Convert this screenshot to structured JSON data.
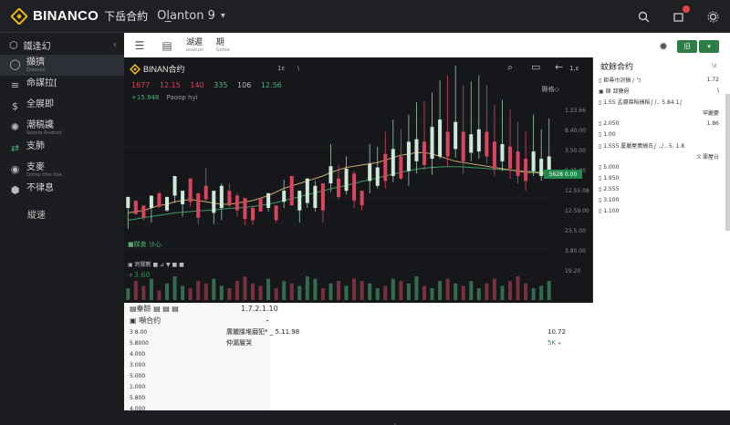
{
  "topbar": {
    "brand": "BINANCO",
    "brand_sub": "下岳合約",
    "account": "Ol̲anton 9",
    "caret": "▾"
  },
  "sidebar": {
    "header": "鐵逢幻",
    "items": [
      {
        "label": "擷擠",
        "sub": "Dolanoo",
        "icon": "circle-icon",
        "active": true
      },
      {
        "label": "命謀拉[",
        "sub": "",
        "icon": "lines-icon",
        "active": false
      },
      {
        "label": "全展即",
        "sub": "",
        "icon": "dollar-icon",
        "active": false
      },
      {
        "label": "潮稿讒",
        "sub": "Sdouta Rusbisd",
        "icon": "gear-icon",
        "active": false
      },
      {
        "label": "支肺",
        "sub": "",
        "icon": "swap-icon",
        "active": false
      },
      {
        "label": "支麥",
        "sub": "Dolleo tthe ihte",
        "icon": "circle-dot-icon",
        "active": false
      },
      {
        "label": "不律息",
        "sub": "",
        "icon": "cube-icon",
        "active": false
      }
    ],
    "footer": "縱速"
  },
  "toolbar": {
    "label_a": "湖遲",
    "label_a_sub": "ooatuoi",
    "label_b": "期",
    "label_b_sub": "Gotoe",
    "btn": "旧 "
  },
  "chart": {
    "title": "BINAN合约",
    "tf1": "1ε",
    "tf2": "\\",
    "right_text": "1.ε",
    "ohlc": [
      "1677",
      "12.15",
      "140",
      "335",
      "106",
      "12.56"
    ],
    "vol_text": "+15.948",
    "vol_text2": "Paoop hyi",
    "hold_text": "縣格◇",
    "price_tag": "5628 0.00",
    "y_ticks": [
      "1.23.66",
      "8.40.00",
      "3.50.00",
      "8.25.00",
      "12.55.08",
      "12.59.00",
      "23.5.00",
      "3.80.00",
      "19.20"
    ],
    "ma_label": "■牒奠 沙心",
    "ind_label": "▣ 跨關數  ■ ⊿  ▼ ■ ■",
    "ind_value": "+3.60"
  },
  "chart_data": {
    "type": "candlestick",
    "candles": [
      [
        0.0,
        -0.55,
        0.3,
        0.75,
        1
      ],
      [
        0.4,
        0.1,
        0.05,
        0.6,
        0
      ],
      [
        0.0,
        -0.2,
        -0.1,
        0.4,
        0
      ],
      [
        0.2,
        -0.3,
        0.3,
        0.8,
        1
      ],
      [
        0.6,
        0.3,
        0.35,
        0.9,
        0
      ],
      [
        0.4,
        0.15,
        0.2,
        0.75,
        1
      ],
      [
        0.5,
        0.5,
        0.8,
        1.6,
        1
      ],
      [
        0.4,
        -0.05,
        0.45,
        1.0,
        1
      ],
      [
        0.9,
        0.35,
        0.55,
        1.5,
        0
      ],
      [
        0.7,
        -0.35,
        -0.1,
        0.9,
        0
      ],
      [
        1.3,
        0.5,
        0.65,
        1.2,
        0
      ],
      [
        0.6,
        -0.35,
        0.1,
        1.0,
        1
      ],
      [
        1.0,
        -0.2,
        0.3,
        1.2,
        1
      ],
      [
        0.9,
        0.35,
        0.4,
        1.0,
        0
      ],
      [
        0.7,
        -0.05,
        0.2,
        0.8,
        0
      ],
      [
        0.6,
        -0.4,
        -0.15,
        0.7,
        0
      ],
      [
        0.6,
        -0.4,
        -0.2,
        0.3,
        0
      ],
      [
        0.5,
        0.45,
        0.15,
        0.7,
        0
      ],
      [
        0.6,
        0.15,
        0.3,
        0.9,
        1
      ],
      [
        0.1,
        -0.3,
        -0.2,
        0.4,
        0
      ],
      [
        0.9,
        0.3,
        0.55,
        1.0,
        1
      ],
      [
        1.2,
        0.4,
        0.4,
        1.6,
        0
      ],
      [
        0.5,
        -0.3,
        0.2,
        1.0,
        1
      ],
      [
        0.9,
        0.3,
        0.5,
        1.5,
        1
      ],
      [
        1.1,
        0.15,
        0.3,
        1.2,
        1
      ],
      [
        0.7,
        -0.3,
        0.2,
        1.3,
        0
      ],
      [
        1.6,
        0.95,
        1.3,
        2.0,
        1
      ],
      [
        1.3,
        0.65,
        0.75,
        1.5,
        0
      ],
      [
        1.4,
        0.85,
        1.0,
        1.9,
        1
      ],
      [
        1.2,
        0.3,
        0.6,
        1.7,
        0
      ],
      [
        0.6,
        0.2,
        0.4,
        1.0,
        0
      ],
      [
        1.5,
        0.9,
        1.4,
        2.1,
        1
      ],
      [
        1.6,
        1.1,
        1.2,
        1.95,
        1
      ],
      [
        2.0,
        1.1,
        1.4,
        2.5,
        0
      ],
      [
        2.3,
        1.35,
        1.6,
        2.7,
        1
      ],
      [
        2.0,
        1.45,
        1.5,
        2.4,
        0
      ],
      [
        2.3,
        1.2,
        1.8,
        3.0,
        1
      ],
      [
        2.4,
        1.7,
        2.2,
        3.1,
        1
      ],
      [
        2.6,
        1.85,
        2.05,
        3.0,
        0
      ],
      [
        2.7,
        1.65,
        2.3,
        3.6,
        1
      ],
      [
        3.1,
        2.3,
        2.4,
        3.9,
        1
      ],
      [
        3.3,
        2.0,
        2.4,
        3.4,
        0
      ],
      [
        3.4,
        2.35,
        2.7,
        3.8,
        1
      ],
      [
        3.1,
        1.7,
        2.2,
        3.4,
        0
      ],
      [
        2.9,
        2.2,
        2.55,
        3.3,
        1
      ],
      [
        3.1,
        2.3,
        2.6,
        3.5,
        1
      ],
      [
        2.9,
        2.1,
        2.4,
        3.4,
        0
      ],
      [
        2.6,
        1.6,
        1.9,
        3.0,
        0
      ],
      [
        2.5,
        1.8,
        2.2,
        2.9,
        1
      ],
      [
        2.4,
        1.5,
        1.9,
        2.8,
        0
      ],
      [
        2.2,
        1.3,
        1.6,
        2.6,
        0
      ],
      [
        2.0,
        1.0,
        1.4,
        2.3,
        0
      ],
      [
        2.3,
        1.6,
        1.8,
        2.6,
        1
      ],
      [
        1.9,
        1.4,
        1.6,
        2.3,
        1
      ],
      [
        2.1,
        1.5,
        1.85,
        2.4,
        1
      ]
    ],
    "candle_fields": [
      "high_offset",
      "low",
      "open_close_lo",
      "open_close_hi",
      "bullish"
    ],
    "volume": [
      5,
      8,
      6,
      9,
      4,
      7,
      10,
      6,
      5,
      8,
      7,
      9,
      6,
      5,
      8,
      10,
      7,
      6,
      9,
      5,
      8,
      7,
      6,
      10,
      9,
      5,
      7,
      8,
      6,
      9,
      8,
      7,
      5,
      6,
      9,
      8,
      7,
      10,
      6,
      5,
      8,
      9,
      7,
      6,
      8,
      5,
      7,
      9,
      6,
      8,
      10,
      7,
      5,
      6,
      8
    ],
    "ma1": [
      0.1,
      0.15,
      0.2,
      0.3,
      0.4,
      0.45,
      0.55,
      0.6,
      0.65,
      0.6,
      0.55,
      0.5,
      0.45,
      0.45,
      0.5,
      0.55,
      0.6,
      0.7,
      0.8,
      0.95,
      1.1,
      1.2,
      1.3,
      1.4,
      1.5,
      1.6,
      1.75,
      1.85,
      1.95,
      2.0,
      2.05,
      2.1,
      2.15,
      2.25,
      2.35,
      2.45,
      2.5,
      2.55,
      2.55,
      2.5,
      2.4,
      2.3,
      2.2,
      2.15,
      2.1,
      2.05,
      2.0,
      1.95,
      1.9,
      1.85,
      1.8,
      1.75,
      1.75,
      1.7,
      1.7
    ],
    "ma2": [
      -0.2,
      -0.15,
      -0.1,
      -0.05,
      0.0,
      0.05,
      0.1,
      0.12,
      0.15,
      0.18,
      0.2,
      0.22,
      0.25,
      0.28,
      0.3,
      0.32,
      0.36,
      0.4,
      0.46,
      0.52,
      0.6,
      0.68,
      0.76,
      0.84,
      0.92,
      1.0,
      1.08,
      1.15,
      1.22,
      1.3,
      1.38,
      1.45,
      1.52,
      1.6,
      1.68,
      1.75,
      1.82,
      1.88,
      1.92,
      1.95,
      1.97,
      1.98,
      1.98,
      1.97,
      1.95,
      1.93,
      1.9,
      1.88,
      1.86,
      1.84,
      1.82,
      1.8,
      1.78,
      1.76,
      1.75
    ]
  },
  "rpanel": {
    "title": "蚊餘合约",
    "close": "\\ε",
    "rows": [
      {
        "l": "▯ 鉅尋巾沢搞 / ㄅ",
        "r": "1.72"
      },
      {
        "l": "▣ 鋳 邽胮俋",
        "r": "\\"
      },
      {
        "l": "▯ 1.55  孟寢酋稻搞稻∫ /.. 5.​84.1∫",
        "r": ""
      },
      {
        "l": "",
        "r": "罕麗夔"
      },
      {
        "l": "▯ 2.050",
        "r": "1.86"
      },
      {
        "l": "▯ 1.00",
        "r": ""
      },
      {
        "l": "▯ 1.555  厦麗屋廣搞氏∫ ../..  5.  1.8",
        "r": ""
      },
      {
        "l": "",
        "r": "ℛ 罪屋㕣"
      },
      {
        "l": "▯ 5.000",
        "r": ""
      },
      {
        "l": "▯ 1.950",
        "r": ""
      },
      {
        "l": "▯ 2.555",
        "r": ""
      },
      {
        "l": "▯ 3.100",
        "r": ""
      },
      {
        "l": "▯ 1.100",
        "r": ""
      }
    ]
  },
  "bottom": {
    "vol_label": "▤秦餘 ▤ ▤ ▤",
    "vol_value": "1.7.2.1.10",
    "title": "▣ 噸合约",
    "title_arrow": "╸",
    "rows": [
      {
        "l": "3 8.00",
        "m": "廣麗牒堆磨犯* _ 5.11.98",
        "r": "10.72",
        "g": false
      },
      {
        "l": "5.8000",
        "m": "仲漏層哭",
        "r": "5K ⁎",
        "g": true
      },
      {
        "l": "4.000",
        "m": "",
        "r": "",
        "g": false
      },
      {
        "l": "3.000",
        "m": "",
        "r": "",
        "g": false
      },
      {
        "l": "5.000",
        "m": "",
        "r": "",
        "g": false
      },
      {
        "l": "1.000",
        "m": "",
        "r": "",
        "g": false
      },
      {
        "l": "5.800",
        "m": "",
        "r": "",
        "g": false
      },
      {
        "l": "4.000",
        "m": "",
        "r": "",
        "g": false
      }
    ]
  },
  "colors": {
    "up": "#4fb07d",
    "down": "#d8455e",
    "accent": "#f0b90b",
    "ma1": "#c9a86a",
    "ma2": "#3c9a5f"
  }
}
